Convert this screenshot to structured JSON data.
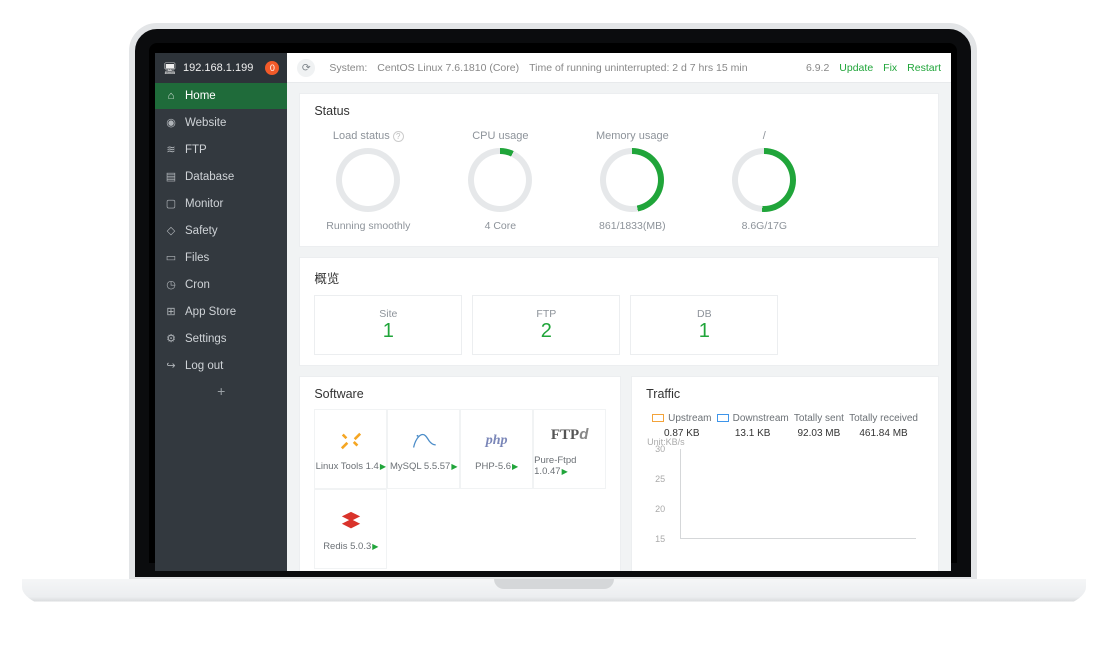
{
  "server_ip": "192.168.1.199",
  "alert_count": "0",
  "topbar": {
    "system_label": "System:",
    "system_value": "CentOS Linux 7.6.1810 (Core)",
    "uptime": "Time of running uninterrupted: 2 d 7 hrs 15 min",
    "version": "6.9.2",
    "update": "Update",
    "fix": "Fix",
    "restart": "Restart"
  },
  "nav": [
    {
      "icon": "⌂",
      "label": "Home"
    },
    {
      "icon": "◉",
      "label": "Website"
    },
    {
      "icon": "≋",
      "label": "FTP"
    },
    {
      "icon": "▤",
      "label": "Database"
    },
    {
      "icon": "▢",
      "label": "Monitor"
    },
    {
      "icon": "◇",
      "label": "Safety"
    },
    {
      "icon": "▭",
      "label": "Files"
    },
    {
      "icon": "◷",
      "label": "Cron"
    },
    {
      "icon": "⊞",
      "label": "App Store"
    },
    {
      "icon": "⚙",
      "label": "Settings"
    },
    {
      "icon": "↪",
      "label": "Log out"
    }
  ],
  "status": {
    "title": "Status",
    "gauges": [
      {
        "label": "Load status",
        "value": "0",
        "pct": 0,
        "sub": "Running smoothly",
        "help": true
      },
      {
        "label": "CPU usage",
        "value": "6.9",
        "pct": 7,
        "sub": "4 Core"
      },
      {
        "label": "Memory usage",
        "value": "47.0",
        "pct": 47,
        "sub": "861/1833(MB)",
        "rocket": true
      },
      {
        "label": "/",
        "value": "51%",
        "pct": 51,
        "sub": "8.6G/17G"
      }
    ]
  },
  "overview": {
    "title": "概览",
    "items": [
      {
        "k": "Site",
        "v": "1"
      },
      {
        "k": "FTP",
        "v": "2"
      },
      {
        "k": "DB",
        "v": "1"
      }
    ]
  },
  "software": {
    "title": "Software",
    "items": [
      {
        "name": "Linux Tools 1.4",
        "icon": "tools"
      },
      {
        "name": "MySQL 5.5.57",
        "icon": "mysql"
      },
      {
        "name": "PHP-5.6",
        "icon": "php"
      },
      {
        "name": "Pure-Ftpd 1.0.47",
        "icon": "ftpd"
      },
      {
        "name": "Redis 5.0.3",
        "icon": "redis"
      }
    ]
  },
  "traffic": {
    "title": "Traffic",
    "legend": [
      {
        "label": "Upstream",
        "value": "0.87 KB",
        "color": "#f3a33a"
      },
      {
        "label": "Downstream",
        "value": "13.1 KB",
        "color": "#3e95ea"
      },
      {
        "label": "Totally sent",
        "value": "92.03 MB"
      },
      {
        "label": "Totally received",
        "value": "461.84 MB"
      }
    ],
    "unit": "Unit:KB/s",
    "yticks": [
      "30",
      "25",
      "20",
      "15"
    ]
  },
  "chart_data": {
    "type": "line",
    "title": "Traffic",
    "ylabel": "KB/s",
    "ylim": [
      15,
      30
    ],
    "series": [
      {
        "name": "Upstream",
        "color": "#f3a33a",
        "values": []
      },
      {
        "name": "Downstream",
        "color": "#3e95ea",
        "values": []
      }
    ],
    "note": "No plotted data points are visible in the screenshot; only axis ticks 15–30 are shown."
  }
}
